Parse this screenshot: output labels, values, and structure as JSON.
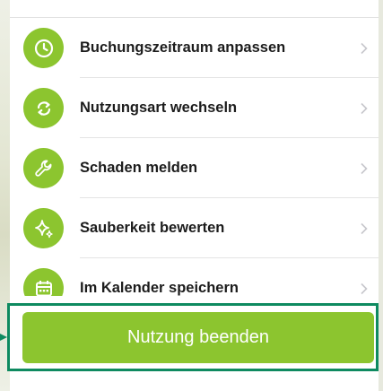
{
  "colors": {
    "accent": "#8cc52f",
    "highlight": "#0e8a60",
    "text": "#1c1c1c",
    "chevron": "#c7c7cc"
  },
  "menu": {
    "items": [
      {
        "label": "Buchungszeitraum anpassen",
        "icon": "clock-icon"
      },
      {
        "label": "Nutzungsart wechseln",
        "icon": "swap-arrows-icon"
      },
      {
        "label": "Schaden melden",
        "icon": "wrench-icon"
      },
      {
        "label": "Sauberkeit bewerten",
        "icon": "sparkle-icon"
      },
      {
        "label": "Im Kalender speichern",
        "icon": "calendar-icon"
      }
    ]
  },
  "footer": {
    "end_button_label": "Nutzung beenden"
  }
}
